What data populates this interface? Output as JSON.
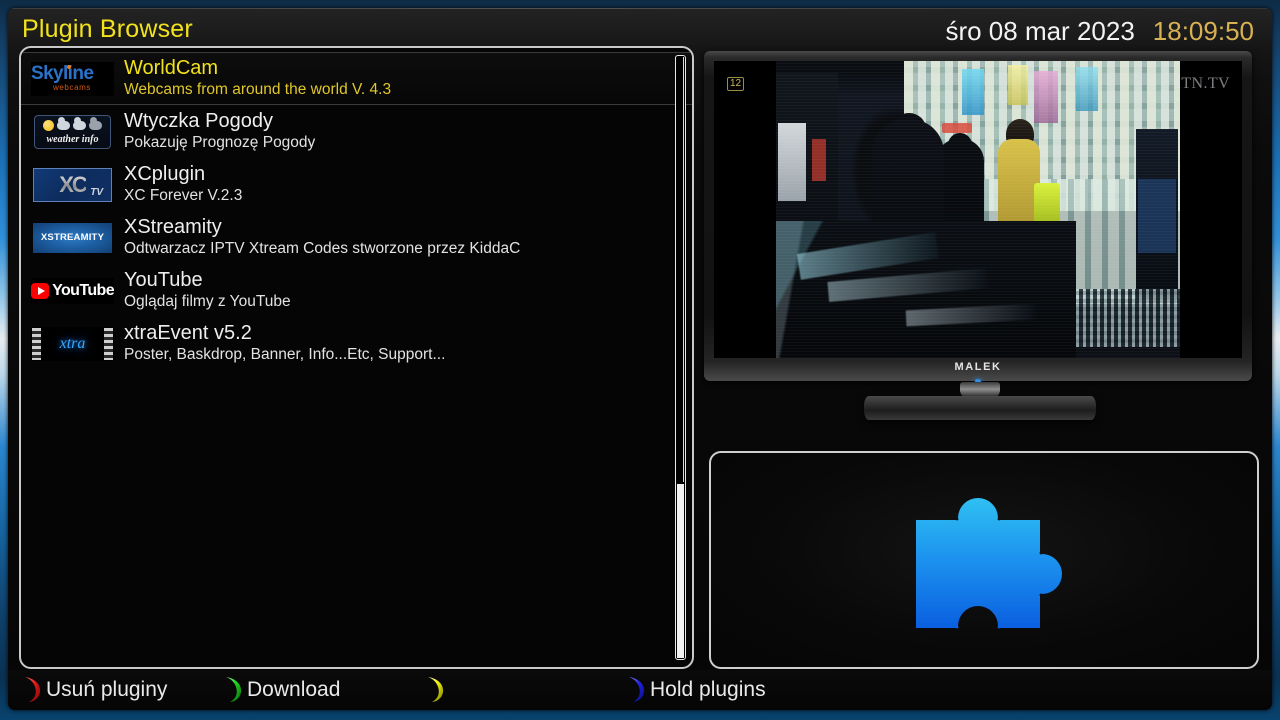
{
  "header": {
    "title": "Plugin Browser",
    "date": "śro 08 mar 2023",
    "time": "18:09:50",
    "title_color": "#f2e21c",
    "time_color": "#d8b153"
  },
  "plugin_list": {
    "selected_index": 0,
    "items": [
      {
        "name": "WorldCam",
        "description": "Webcams from around the world V. 4.3",
        "icon": "skyline-webcams-logo",
        "selected": true
      },
      {
        "name": "Wtyczka Pogody",
        "description": "Pokazuję Prognozę Pogody",
        "icon": "weather-info-logo",
        "selected": false
      },
      {
        "name": "XCplugin",
        "description": "XC Forever V.2.3",
        "icon": "xc-tv-logo",
        "selected": false
      },
      {
        "name": "XStreamity",
        "description": "Odtwarzacz IPTV Xtream Codes stworzone przez KiddaC",
        "icon": "xstreamity-logo",
        "selected": false
      },
      {
        "name": "YouTube",
        "description": "Oglądaj filmy z YouTube",
        "icon": "youtube-logo",
        "selected": false
      },
      {
        "name": "xtraEvent v5.2",
        "description": "Poster, Baskdrop, Banner, Info...Etc, Support...",
        "icon": "xtra-event-logo",
        "selected": false
      }
    ]
  },
  "icons": {
    "skyline_main": "Skyline",
    "skyline_sub": "webcams",
    "weather_label": "weather info",
    "xc_main": "XC",
    "xc_sub": "TV",
    "xstreamity_label": "XSTREAMITY",
    "youtube_word": "YouTube",
    "xtra_word": "xtra"
  },
  "preview": {
    "tv_brand": "MALEK",
    "channel_rating": "12",
    "channel_logo": "ITN.TV"
  },
  "puzzle": {
    "icon": "puzzle-piece-icon",
    "gradient_top": "#2fb8ef",
    "gradient_bottom": "#0a62e0"
  },
  "buttons": [
    {
      "color_name": "red",
      "color": "#e01b1b",
      "label": "Usuń pluginy"
    },
    {
      "color_name": "green",
      "color": "#1fd41f",
      "label": "Download"
    },
    {
      "color_name": "yellow",
      "color": "#ecec12",
      "label": ""
    },
    {
      "color_name": "blue",
      "color": "#2323e6",
      "label": "Hold plugins"
    }
  ]
}
